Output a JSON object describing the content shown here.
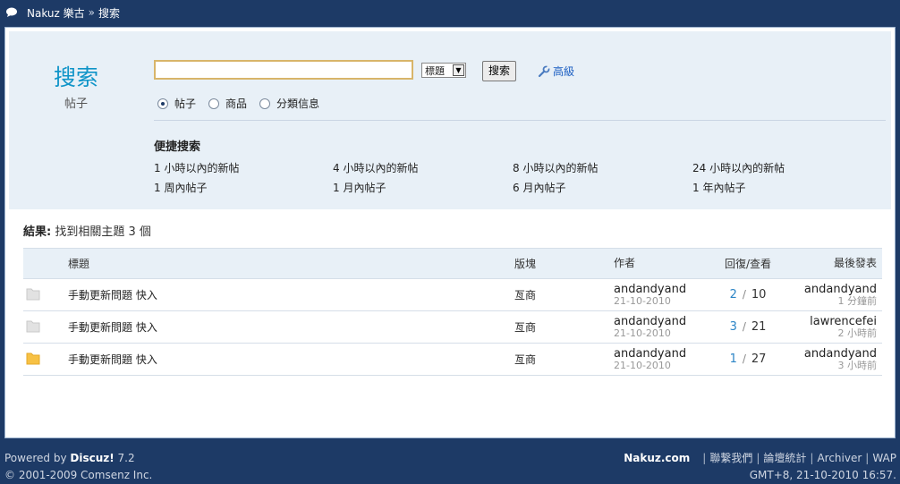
{
  "breadcrumb": {
    "home": "Nakuz 樂古",
    "separator": "»",
    "current": "搜索"
  },
  "search": {
    "heading": "搜索",
    "subheading": "帖子",
    "keyword_value": "",
    "scope_select": "標題",
    "submit_label": "搜索",
    "advanced_label": "高級",
    "types": [
      {
        "label": "帖子",
        "checked": true
      },
      {
        "label": "商品",
        "checked": false
      },
      {
        "label": "分類信息",
        "checked": false
      }
    ],
    "quick_title": "便捷搜索",
    "quick_links": [
      "1 小時以內的新帖",
      "4 小時以內的新帖",
      "8 小時以內的新帖",
      "24 小時以內的新帖",
      "1 周內帖子",
      "1 月內帖子",
      "6 月內帖子",
      "1 年內帖子"
    ]
  },
  "results": {
    "summary_label": "結果:",
    "summary_text": " 找到相關主題 3 個",
    "headers": {
      "title": "標題",
      "forum": "版塊",
      "author": "作者",
      "replies_views": "回復/查看",
      "lastpost": "最後發表"
    },
    "rows": [
      {
        "icon": "folder-grey-icon",
        "title": "手動更新問題 快入",
        "forum": "亙商",
        "author": "andandyand",
        "date": "21-10-2010",
        "replies": "2",
        "views": "10",
        "last_user": "andandyand",
        "last_time": "1 分鐘前"
      },
      {
        "icon": "folder-grey-icon",
        "title": "手動更新問題 快入",
        "forum": "亙商",
        "author": "andandyand",
        "date": "21-10-2010",
        "replies": "3",
        "views": "21",
        "last_user": "lawrencefei",
        "last_time": "2 小時前"
      },
      {
        "icon": "folder-hot-icon",
        "title": "手動更新問題 快入",
        "forum": "亙商",
        "author": "andandyand",
        "date": "21-10-2010",
        "replies": "1",
        "views": "27",
        "last_user": "andandyand",
        "last_time": "3 小時前"
      }
    ]
  },
  "footer": {
    "powered_prefix": "Powered by ",
    "powered_brand": "Discuz!",
    "powered_version": " 7.2",
    "copyright": "© 2001-2009 Comsenz Inc.",
    "site": "Nakuz.com",
    "links": [
      "聯繫我們",
      "論壇統計",
      "Archiver",
      "WAP"
    ],
    "time": "GMT+8, 21-10-2010 16:57."
  },
  "colors": {
    "brand_navy": "#1d3a66",
    "panel_bg": "#e8f0f7",
    "heading_blue": "#0f94c8",
    "link_blue": "#1b5ec2",
    "hot_folder": "#f7c144"
  }
}
